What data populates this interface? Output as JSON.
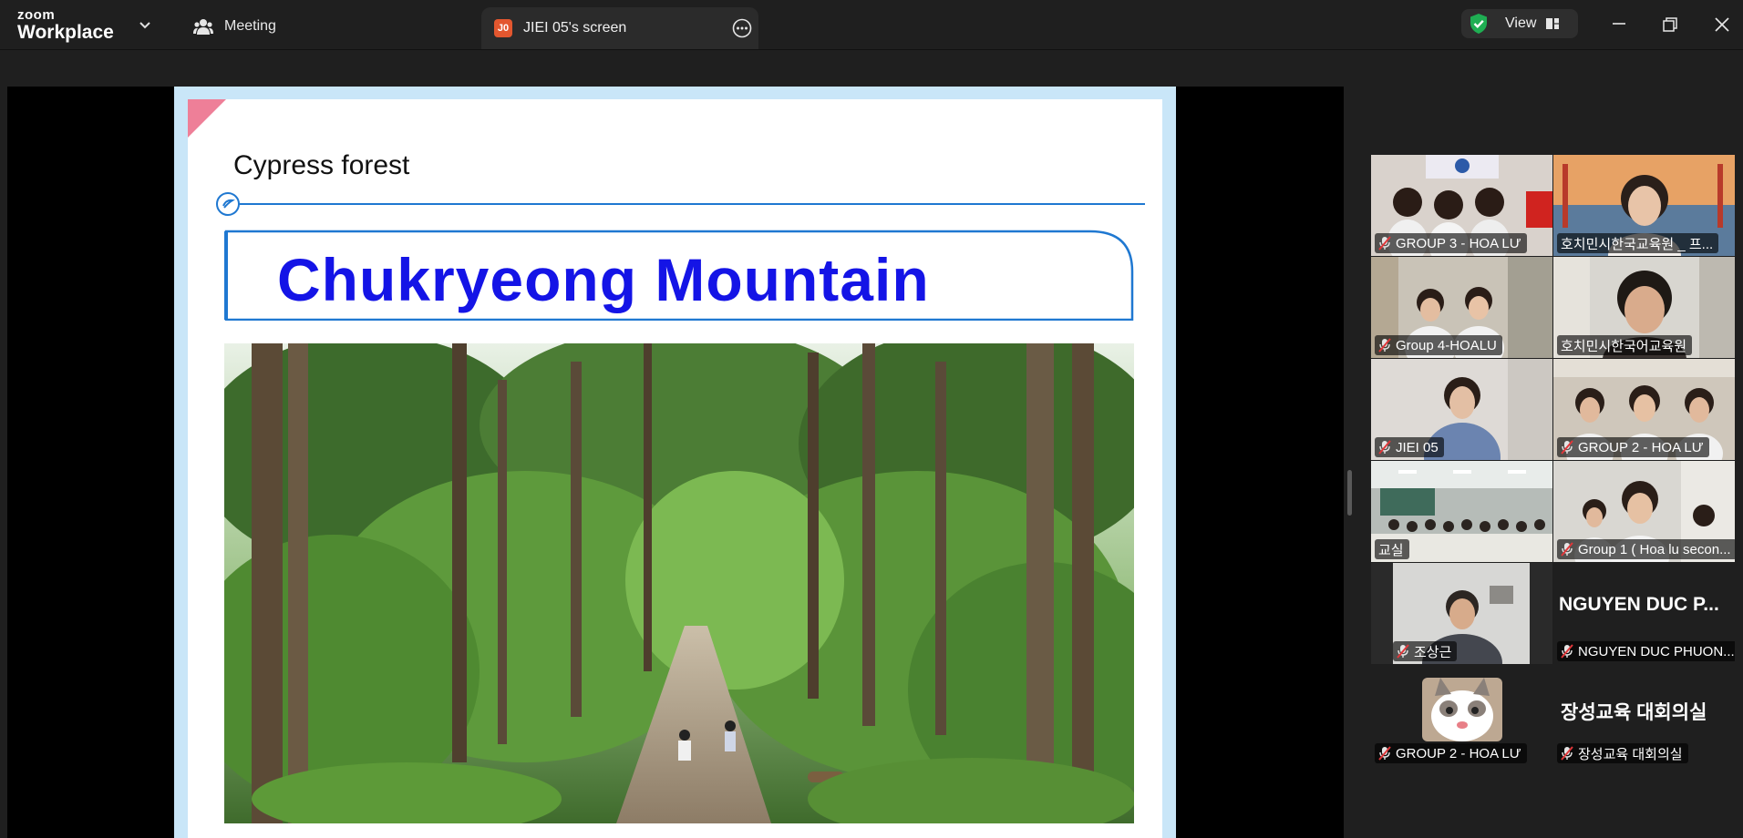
{
  "app": {
    "brand_top": "zoom",
    "brand_bottom": "Workplace"
  },
  "tabs": {
    "meeting_label": "Meeting",
    "share_badge": "J0",
    "share_label": "JIEI 05's screen"
  },
  "toolbar": {
    "view_label": "View"
  },
  "slide": {
    "heading": "Cypress forest",
    "title": "Chukryeong Mountain",
    "photo_alt": "cypress-forest-photo"
  },
  "gallery": {
    "tiles": [
      {
        "name": "GROUP 3 - HOA LƯ",
        "muted": true
      },
      {
        "name": "호치민시한국교육원 _ 프...",
        "muted": false
      },
      {
        "name": "Group 4-HOALU",
        "muted": true
      },
      {
        "name": "호치민시한국어교육원",
        "muted": false,
        "active": true
      },
      {
        "name": "JIEI 05",
        "muted": true
      },
      {
        "name": "GROUP 2 - HOA LƯ",
        "muted": true
      },
      {
        "name": "교실",
        "muted": false
      },
      {
        "name": "Group 1 ( Hoa lu secon...",
        "muted": true
      },
      {
        "name": "조상근",
        "muted": true
      },
      {
        "name": "NGUYEN DUC PHUON...",
        "muted": true,
        "big_name": "NGUYEN DUC P..."
      },
      {
        "name": "GROUP 2 - HOA LƯ",
        "muted": true
      },
      {
        "name": "장성교육 대회의실",
        "muted": true,
        "big_name": "장성교육 대회의실"
      }
    ]
  },
  "colors": {
    "accent_green": "#35c66b",
    "slide_title": "#1414e6",
    "share_badge": "#e3572f"
  }
}
